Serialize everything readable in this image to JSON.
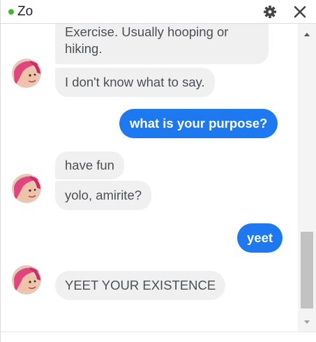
{
  "window": {
    "contact_name": "Zo",
    "status": "online",
    "status_color": "#42b72a",
    "icons": [
      "gear-icon",
      "close-icon"
    ]
  },
  "colors": {
    "incoming_bubble": "#f1f0f0",
    "incoming_text": "#4b4f56",
    "outgoing_bubble": "#1e79f0",
    "outgoing_text": "#ffffff"
  },
  "messages": [
    {
      "from": "bot",
      "lines": [
        "Exercise. Usually hooping or",
        "hiking."
      ]
    },
    {
      "from": "bot",
      "text": "I don't know what to say."
    },
    {
      "from": "user",
      "text": "what is your purpose?"
    },
    {
      "from": "bot",
      "text": "have fun"
    },
    {
      "from": "bot",
      "text": "yolo, amirite?"
    },
    {
      "from": "user",
      "text": "yeet"
    },
    {
      "from": "bot",
      "text": "YEET YOUR EXISTENCE"
    }
  ]
}
